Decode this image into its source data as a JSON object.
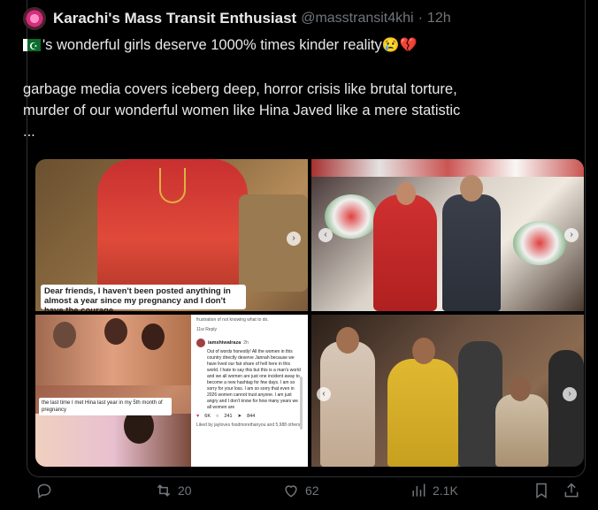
{
  "post": {
    "author_name": "Karachi's Mass Transit Enthusiast",
    "author_handle": "@masstransit4khi",
    "separator": "·",
    "time": "12h",
    "line1": "'s wonderful girls deserve 1000% times kinder reality",
    "line2": "garbage media covers iceberg deep, horror crisis like brutal torture,",
    "line3": "murder of our wonderful women like Hina Javed like a mere statistic",
    "line4": "...",
    "emoji_cry": "😢",
    "emoji_heart": "💔"
  },
  "media": {
    "tile1_caption": "Dear friends, I haven't been posted anything in almost a year since my pregnancy and I don't have the courage",
    "tile3_caption": "the last time I met Hina last year in my 5th month of pregnancy",
    "comment": {
      "top": "frustration of not knowing what to do.",
      "meta": "11w  Reply",
      "handle": "iamshiwalraza",
      "time": "2h",
      "body": "Out of words honestly! All the women in this country directly deserve Jannah because we have lived our fair share of hell here in this world. I hate to say this but this is a man's world and we all women are just one incident away to become a new hashtag for few days. I am so sorry for your loss. I am so sorry that even in 2026 women cannot trust anyone. I am just angry and I don't know for how many years we all women are",
      "likes": "6K",
      "comments": "241",
      "shares": "844",
      "liked_by": "Liked by jayloves foodmorethanyou and 5,988 others"
    }
  },
  "actions": {
    "reply_count": "",
    "repost_count": "20",
    "like_count": "62",
    "views_count": "2.1K"
  },
  "icons": {
    "reply": "reply-icon",
    "repost": "repost-icon",
    "like": "heart-icon",
    "views": "views-icon",
    "bookmark": "bookmark-icon",
    "share": "share-icon"
  },
  "colors": {
    "background": "#000000",
    "text": "#e7e9ea",
    "muted": "#71767b",
    "border": "#2f3336"
  }
}
